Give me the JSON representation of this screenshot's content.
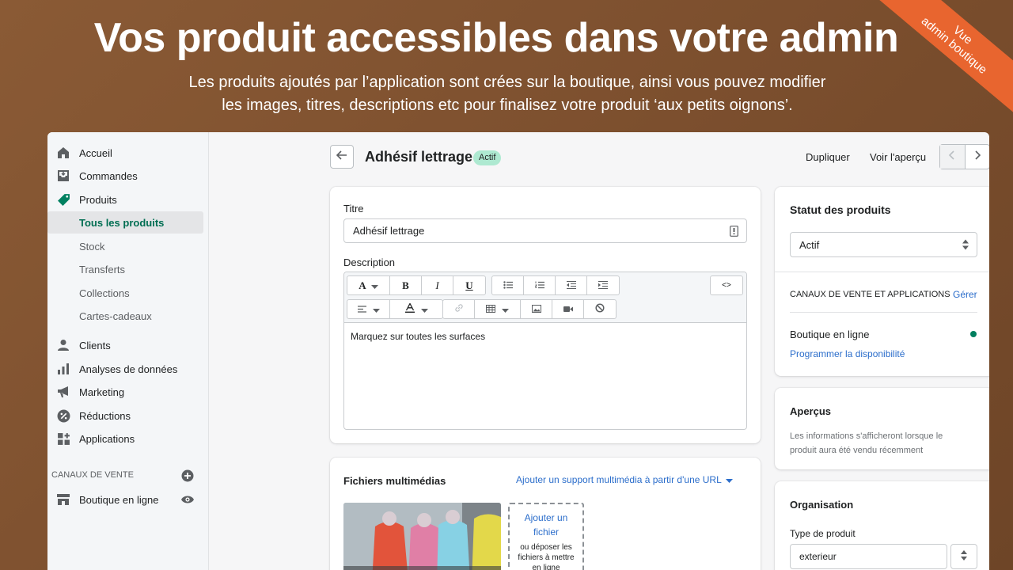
{
  "hero": {
    "title": "Vos produit accessibles dans votre admin",
    "subtitle_line1": "Les produits ajoutés par l’application sont crées sur la boutique, ainsi vous pouvez modifier",
    "subtitle_line2": "les images, titres, descriptions etc pour finalisez votre produit ‘aux petits oignons’.",
    "ribbon_line1": "Vue",
    "ribbon_line2": "admin boutique"
  },
  "colors": {
    "accent": "#006e52",
    "badge": "#aee9d1",
    "link": "#2c6ecb",
    "ribbon": "#e8652f",
    "status_dot": "#007f5f"
  },
  "sidebar": {
    "items": [
      {
        "label": "Accueil",
        "icon": "home-icon"
      },
      {
        "label": "Commandes",
        "icon": "orders-icon"
      },
      {
        "label": "Produits",
        "icon": "tag-icon"
      },
      {
        "label": "Tous les produits"
      },
      {
        "label": "Stock"
      },
      {
        "label": "Transferts"
      },
      {
        "label": "Collections"
      },
      {
        "label": "Cartes-cadeaux"
      },
      {
        "label": "Clients",
        "icon": "person-icon"
      },
      {
        "label": "Analyses de données",
        "icon": "bar-chart-icon"
      },
      {
        "label": "Marketing",
        "icon": "megaphone-icon"
      },
      {
        "label": "Réductions",
        "icon": "discount-icon"
      },
      {
        "label": "Applications",
        "icon": "apps-icon"
      }
    ],
    "channels_label": "CANAUX DE VENTE",
    "channel_item": "Boutique en ligne"
  },
  "header": {
    "title": "Adhésif lettrage",
    "status_badge": "Actif",
    "duplicate": "Dupliquer",
    "preview": "Voir l'aperçu"
  },
  "product": {
    "title_label": "Titre",
    "title_value": "Adhésif lettrage",
    "description_label": "Description",
    "description_text": "Marquez sur toutes les surfaces",
    "editor": {
      "font_button": "A",
      "bold": "B",
      "italic": "I",
      "underline": "U",
      "code": "<>"
    }
  },
  "media": {
    "heading": "Fichiers multimédias",
    "url_link": "Ajouter un support multimédia à partir d'une URL",
    "add_file": "Ajouter un fichier",
    "drop_hint_line1": "ou déposer les",
    "drop_hint_line2": "fichiers à mettre",
    "drop_hint_line3": "en ligne"
  },
  "status_card": {
    "heading": "Statut des produits",
    "selected": "Actif",
    "channels_heading": "CANAUX DE VENTE ET APPLICATIONS",
    "manage": "Gérer",
    "channel": "Boutique en ligne",
    "schedule": "Programmer la disponibilité"
  },
  "insights": {
    "heading": "Aperçus",
    "text_line1": "Les informations s'afficheront lorsque le",
    "text_line2": "produit aura été vendu récemment"
  },
  "organisation": {
    "heading": "Organisation",
    "type_label": "Type de produit",
    "type_value": "exterieur"
  }
}
